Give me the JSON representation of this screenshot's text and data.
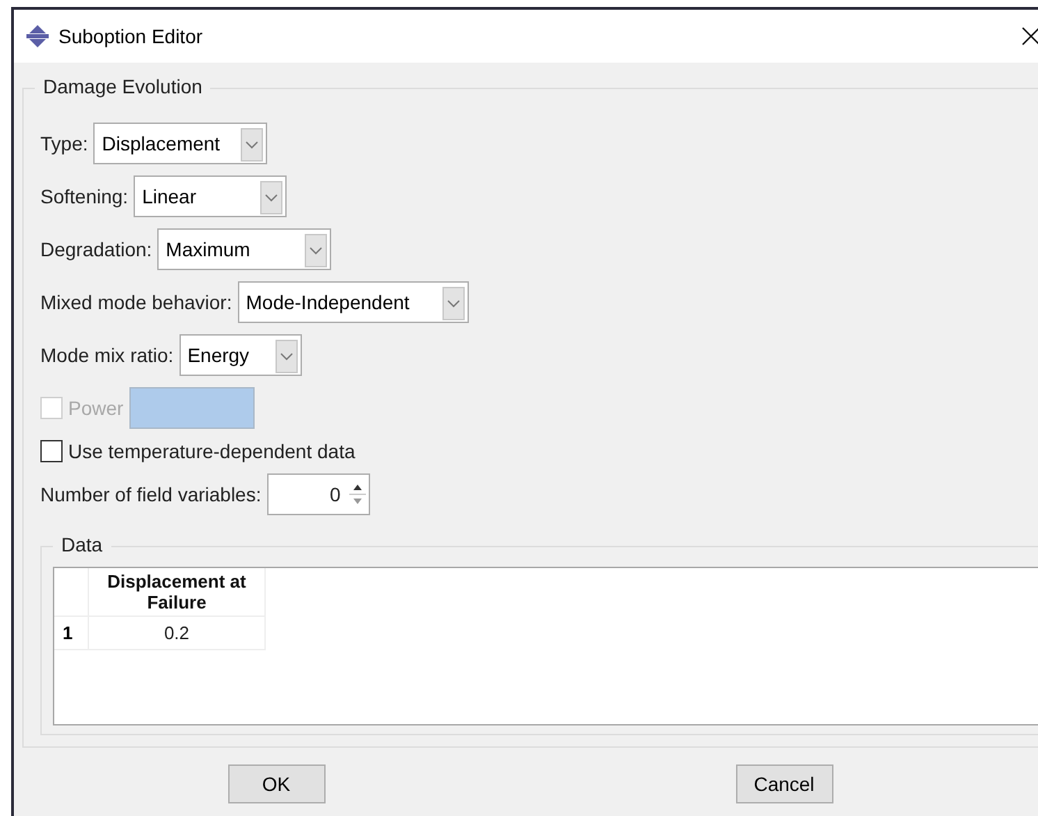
{
  "window": {
    "title": "Suboption Editor"
  },
  "group": {
    "title": "Damage Evolution",
    "selects": [
      {
        "label": "Type:",
        "value": "Displacement"
      },
      {
        "label": "Softening:",
        "value": "Linear"
      },
      {
        "label": "Degradation:",
        "value": "Maximum"
      },
      {
        "label": "Mixed mode behavior:",
        "value": "Mode-Independent"
      },
      {
        "label": "Mode mix ratio:",
        "value": "Energy"
      }
    ],
    "power": {
      "label": "Power",
      "checked": false,
      "disabled": true
    },
    "temperature": {
      "label": "Use temperature-dependent data",
      "checked": false,
      "disabled": false
    },
    "field_variables": {
      "label": "Number of field variables:",
      "value": "0"
    },
    "data": {
      "title": "Data",
      "columns": [
        "Displacement at Failure"
      ],
      "rows": [
        {
          "index": "1",
          "cells": [
            "0.2"
          ]
        }
      ]
    }
  },
  "buttons": [
    "OK",
    "Cancel"
  ]
}
